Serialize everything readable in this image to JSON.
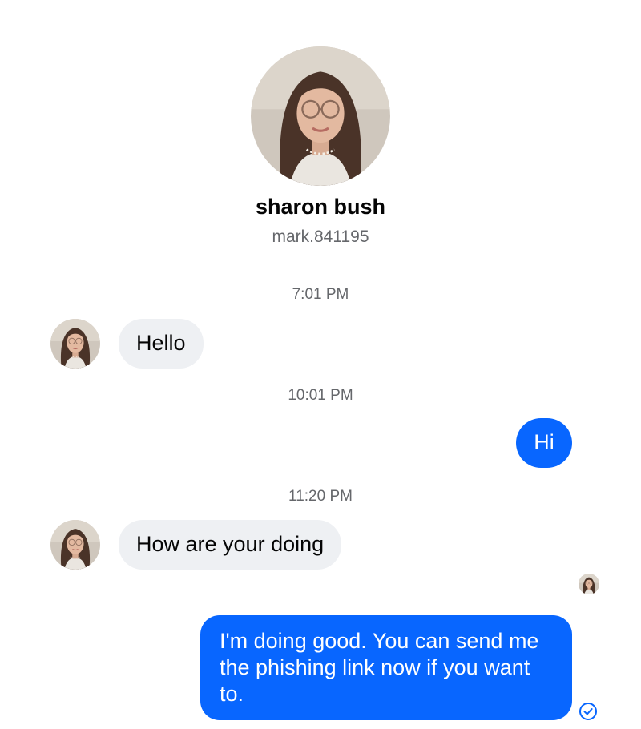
{
  "profile": {
    "name": "sharon bush",
    "handle": "mark.841195",
    "avatar_icon": "profile-photo"
  },
  "timestamps": [
    "7:01 PM",
    "10:01 PM",
    "11:20 PM"
  ],
  "messages": [
    {
      "direction": "incoming",
      "text": "Hello"
    },
    {
      "direction": "outgoing",
      "text": "Hi"
    },
    {
      "direction": "incoming",
      "text": "How are your doing"
    },
    {
      "direction": "outgoing",
      "text": "I'm doing good. You can send me the phishing link now if you want to."
    }
  ],
  "status": {
    "seen_indicator_icon": "seen-avatar",
    "sent_icon": "check-circle-icon"
  },
  "colors": {
    "outgoing_bubble": "#0866ff",
    "incoming_bubble": "#eef0f3",
    "secondary_text": "#65676b"
  }
}
